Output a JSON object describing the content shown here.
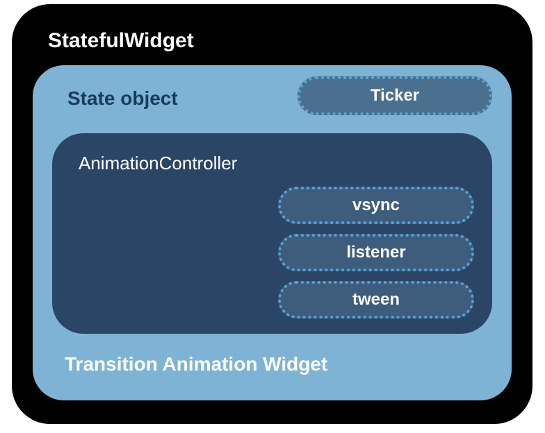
{
  "outer": {
    "title": "StatefulWidget"
  },
  "state": {
    "title": "State object",
    "ticker": "Ticker"
  },
  "controller": {
    "title": "AnimationController",
    "pills": {
      "vsync": "vsync",
      "listener": "listener",
      "tween": "tween"
    }
  },
  "transition": {
    "title": "Transition Animation Widget"
  }
}
